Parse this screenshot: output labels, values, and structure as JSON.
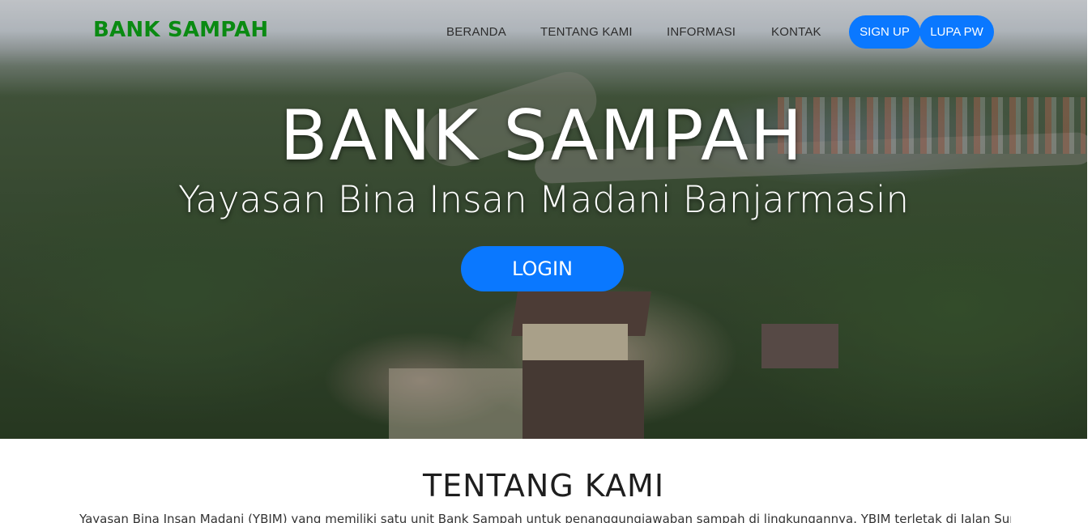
{
  "nav": {
    "brand": "BANK SAMPAH",
    "links": [
      "BERANDA",
      "TENTANG KAMI",
      "INFORMASI",
      "KONTAK"
    ],
    "signup_label": "SIGN UP",
    "forgot_label": "LUPA PW"
  },
  "hero": {
    "title": "BANK SAMPAH",
    "subtitle": "Yayasan Bina Insan Madani Banjarmasin",
    "login_label": "LOGIN"
  },
  "about": {
    "title": "TENTANG KAMI",
    "text": "Yayasan Bina Insan Madani (YBIM) yang memiliki satu unit Bank Sampah untuk penanggungjawaban sampah di lingkungannya. YBIM terletak di Jalan Sungai Gampa"
  },
  "colors": {
    "brand": "#0a8a12",
    "accent": "#0a78ff"
  }
}
